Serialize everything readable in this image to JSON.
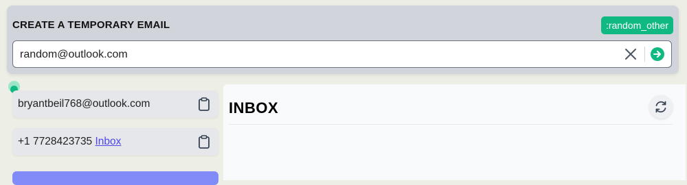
{
  "create": {
    "title": "CREATE A TEMPORARY EMAIL",
    "badge": ":random_other",
    "email_value": "random@outlook.com"
  },
  "sidebar": {
    "email": "bryantbeil768@outlook.com",
    "phone": "+1 7728423735",
    "phone_link": "Inbox"
  },
  "inbox": {
    "title": "INBOX"
  },
  "icons": [
    "close-icon",
    "arrow-right-icon",
    "clipboard-icon",
    "refresh-icon"
  ],
  "colors": {
    "accent": "#10b981",
    "link": "#4f46e5",
    "button": "#818cf8"
  }
}
